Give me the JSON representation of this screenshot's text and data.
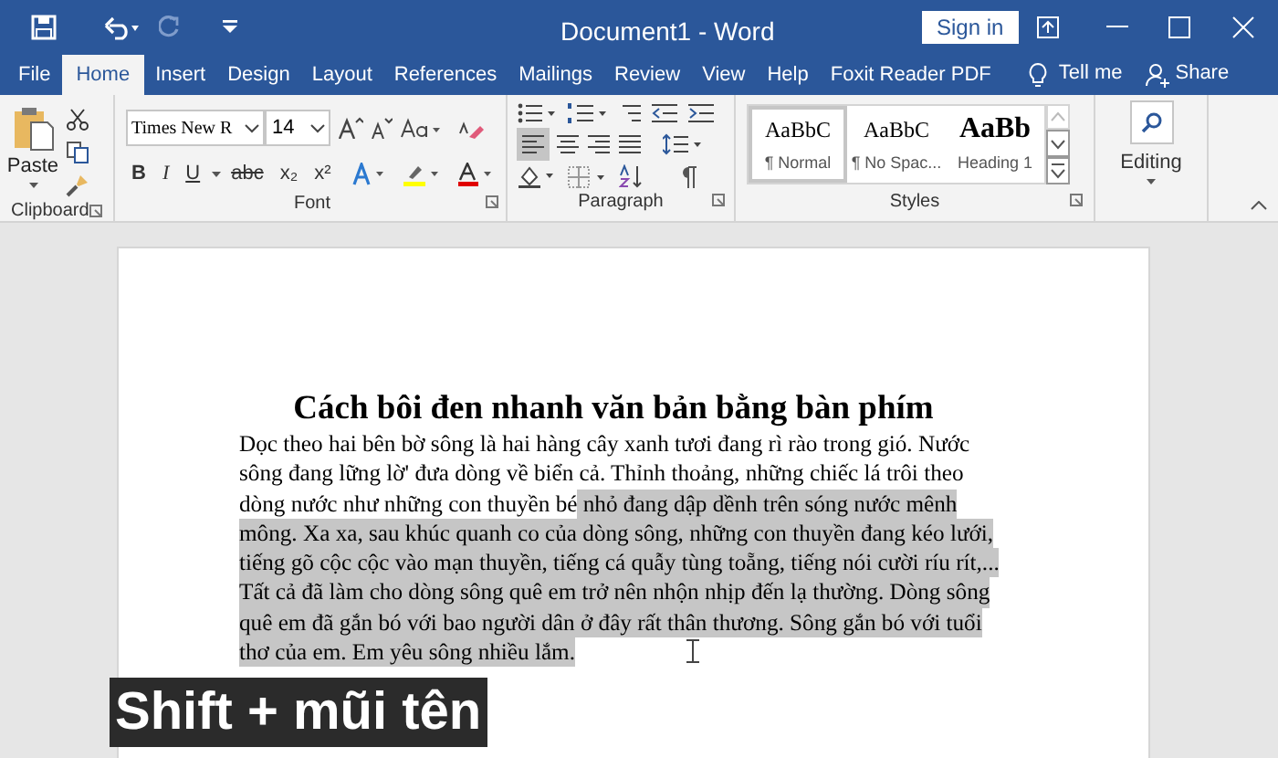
{
  "window": {
    "title": "Document1  -  Word",
    "sign_in": "Sign in"
  },
  "tabs": [
    {
      "label": "File",
      "selected": false
    },
    {
      "label": "Home",
      "selected": true
    },
    {
      "label": "Insert",
      "selected": false
    },
    {
      "label": "Design",
      "selected": false
    },
    {
      "label": "Layout",
      "selected": false
    },
    {
      "label": "References",
      "selected": false
    },
    {
      "label": "Mailings",
      "selected": false
    },
    {
      "label": "Review",
      "selected": false
    },
    {
      "label": "View",
      "selected": false
    },
    {
      "label": "Help",
      "selected": false
    },
    {
      "label": "Foxit Reader PDF",
      "selected": false
    }
  ],
  "tell_me": "Tell me",
  "share": "Share",
  "clipboard": {
    "paste": "Paste",
    "label": "Clipboard"
  },
  "font": {
    "name": "Times New R",
    "size": "14",
    "format_buttons": [
      "B",
      "I",
      "U",
      "abc",
      "x₂",
      "x²"
    ],
    "label": "Font"
  },
  "paragraph": {
    "label": "Paragraph",
    "align_left_selected": true
  },
  "styles": {
    "label": "Styles",
    "items": [
      {
        "preview": "AaBbC",
        "name": "¶ Normal",
        "selected": true,
        "kind": "normal"
      },
      {
        "preview": "AaBbC",
        "name": "¶ No Spac...",
        "selected": false,
        "kind": "normal"
      },
      {
        "preview": "AaBb",
        "name": "Heading 1",
        "selected": false,
        "kind": "heading"
      }
    ]
  },
  "editing": {
    "label": "Editing"
  },
  "document": {
    "title": "Cách bôi đen nhanh văn bản bằng bàn phím",
    "lines": [
      [
        {
          "text": "Dọc theo hai bên bờ sông là hai hàng cây xanh tươi đang rì rào trong gió. Nước",
          "selected": false
        }
      ],
      [
        {
          "text": "sông đang lững lờ' đưa dòng về biển cả. Thỉnh thoảng, những chiếc lá trôi theo",
          "selected": false
        }
      ],
      [
        {
          "text": "dòng nước như những con thuyền bé",
          "selected": false
        },
        {
          "text": " nhỏ đang dập dềnh trên sóng nước mênh",
          "selected": true
        }
      ],
      [
        {
          "text": "mông. Xa xa, sau khúc quanh co của dòng sông, những con thuyền đang kéo lưới,",
          "selected": true
        }
      ],
      [
        {
          "text": "tiếng gõ cộc cộc vào mạn thuyền, tiếng cá quẫy tùng toẵng, tiếng nói cười ríu rít,...",
          "selected": true
        }
      ],
      [
        {
          "text": "Tất cả đã làm cho dòng sông quê em trở nên nhộn nhịp đến lạ thường. Dòng sông",
          "selected": true
        }
      ],
      [
        {
          "text": "quê em đã gắn bó với bao người dân ở đây rất thân thương. Sông gắn bó với tuổi",
          "selected": true
        }
      ],
      [
        {
          "text": "thơ của em. Em yêu sông nhiều lắm.",
          "selected": true
        }
      ]
    ]
  },
  "caption": "Shift + mũi tên"
}
